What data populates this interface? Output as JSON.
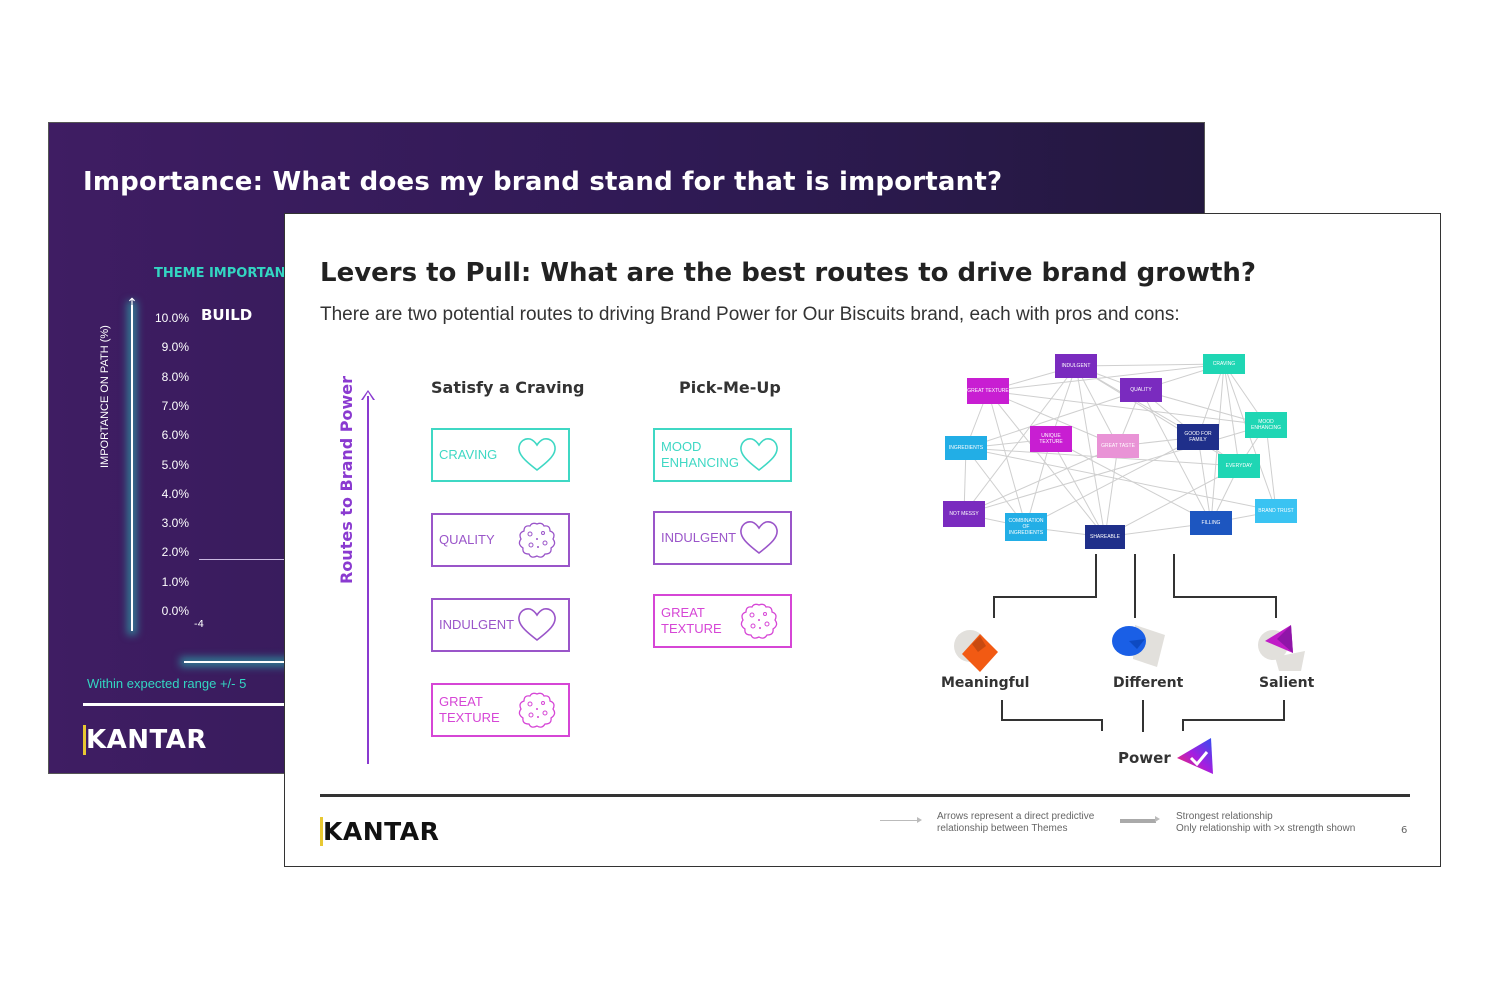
{
  "back_slide": {
    "title": "Importance: What does my brand stand for that is important?",
    "section_label": "THEME IMPORTANCE",
    "y_axis_label": "IMPORTANCE ON PATH (%)",
    "y_ticks": [
      "10.0%",
      "9.0%",
      "8.0%",
      "7.0%",
      "6.0%",
      "5.0%",
      "4.0%",
      "3.0%",
      "2.0%",
      "1.0%",
      "0.0%"
    ],
    "quadrant_label": "BUILD",
    "x_tick": "-4",
    "range_note": "Within expected range +/- 5",
    "logo": "KANTAR"
  },
  "front_slide": {
    "title": "Levers to Pull: What are the best routes to drive brand growth?",
    "subtitle": "There are two potential routes to driving Brand Power for Our Biscuits brand, each with pros and cons:",
    "axis_label": "Routes to Brand Power",
    "routes": [
      {
        "heading": "Satisfy a Craving",
        "themes": [
          {
            "line1": "CRAVING",
            "line2": "",
            "icon": "heart-icon",
            "color": "#3fd8c4"
          },
          {
            "line1": "QUALITY",
            "line2": "",
            "icon": "cookie-icon",
            "color": "#9a55c9"
          },
          {
            "line1": "INDULGENT",
            "line2": "",
            "icon": "heart-icon",
            "color": "#9a55c9"
          },
          {
            "line1": "GREAT",
            "line2": "TEXTURE",
            "icon": "cookie-icon",
            "color": "#d646d6"
          }
        ]
      },
      {
        "heading": "Pick-Me-Up",
        "themes": [
          {
            "line1": "MOOD",
            "line2": "ENHANCING",
            "icon": "heart-icon",
            "color": "#3fd8c4"
          },
          {
            "line1": "INDULGENT",
            "line2": "",
            "icon": "heart-icon",
            "color": "#9a55c9"
          },
          {
            "line1": "GREAT",
            "line2": "TEXTURE",
            "icon": "cookie-icon",
            "color": "#d646d6"
          }
        ]
      }
    ],
    "network_nodes": [
      {
        "id": "indulgent",
        "label": "INDULGENT",
        "color": "#7a2bbf"
      },
      {
        "id": "craving",
        "label": "CRAVING",
        "color": "#1fd6b4"
      },
      {
        "id": "great_texture",
        "label": "GREAT TEXTURE",
        "color": "#c81ed2"
      },
      {
        "id": "quality",
        "label": "QUALITY",
        "color": "#7a2bbf"
      },
      {
        "id": "mood_enhancing",
        "label": "MOOD ENHANCING",
        "color": "#1fd6b4"
      },
      {
        "id": "ingredients",
        "label": "INGREDIENTS",
        "color": "#22aee6"
      },
      {
        "id": "unique_texture",
        "label": "UNIQUE TEXTURE",
        "color": "#c81ed2"
      },
      {
        "id": "great_taste",
        "label": "GREAT TASTE",
        "color": "#e993d6"
      },
      {
        "id": "good_for_family",
        "label": "GOOD FOR FAMILY",
        "color": "#1f2f8a"
      },
      {
        "id": "everyday",
        "label": "EVERYDAY",
        "color": "#1fd6b4"
      },
      {
        "id": "not_messy",
        "label": "NOT MESSY",
        "color": "#7a2bbf"
      },
      {
        "id": "combination",
        "label": "COMBINATION OF INGREDIENTS",
        "color": "#22aee6"
      },
      {
        "id": "shareable",
        "label": "SHAREABLE",
        "color": "#1f2f8a"
      },
      {
        "id": "filling",
        "label": "FILLING",
        "color": "#1d56c0"
      },
      {
        "id": "brand_trust",
        "label": "BRAND TRUST",
        "color": "#3ac3f2"
      }
    ],
    "drivers": {
      "meaningful": "Meaningful",
      "different": "Different",
      "salient": "Salient",
      "power": "Power"
    },
    "legend": {
      "arrow_note": "Arrows represent a direct predictive relationship between Themes",
      "arrow_note_line1": "Arrows represent a direct predictive",
      "arrow_note_line2": "relationship between Themes",
      "strong_line1": "Strongest relationship",
      "strong_line2": "Only relationship with >x strength shown"
    },
    "page_number": "6",
    "logo": "KANTAR"
  }
}
